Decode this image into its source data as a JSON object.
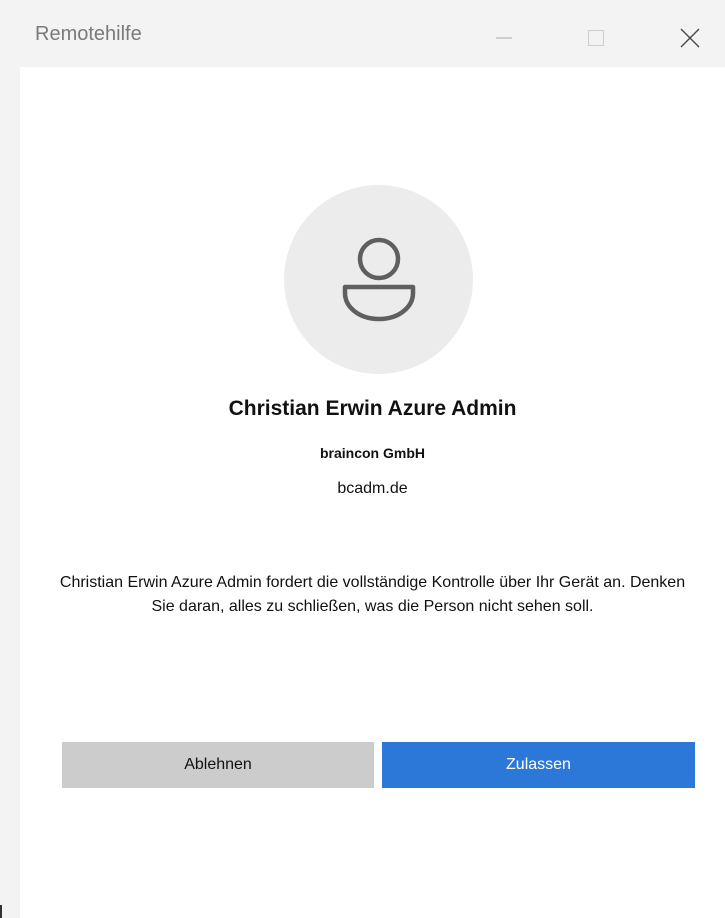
{
  "window": {
    "title": "Remotehilfe",
    "controls": {
      "minimize_icon": "minimize-icon",
      "maximize_icon": "maximize-icon",
      "close_icon": "close-icon"
    }
  },
  "requester": {
    "avatar_icon": "person-icon",
    "name": "Christian Erwin Azure Admin",
    "organization": "braincon GmbH",
    "domain": "bcadm.de"
  },
  "message": "Christian Erwin Azure Admin fordert die vollständige Kontrolle über Ihr Gerät an. Denken Sie daran, alles zu schließen, was die Person nicht sehen soll.",
  "actions": {
    "decline_label": "Ablehnen",
    "allow_label": "Zulassen"
  },
  "colors": {
    "accent": "#2b78d8",
    "decline_bg": "#cccccc",
    "avatar_bg": "#ececec"
  }
}
